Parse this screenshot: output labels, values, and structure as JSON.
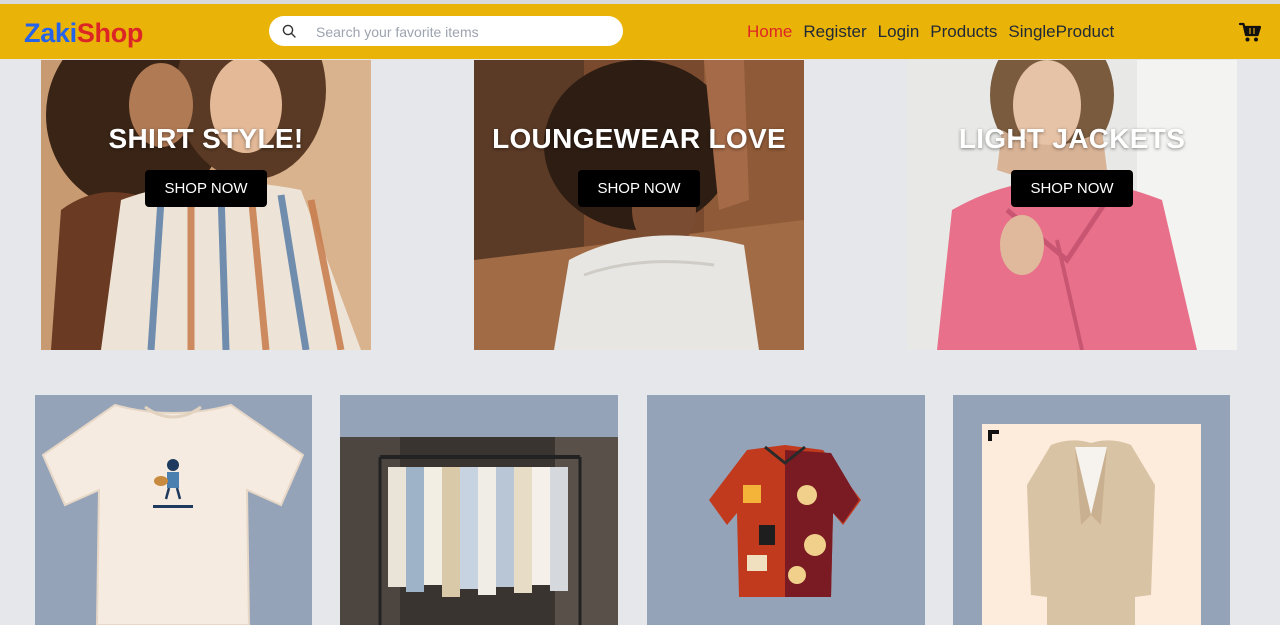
{
  "brand": {
    "part1": "Zaki",
    "part2": "Shop"
  },
  "search": {
    "placeholder": "Search your favorite items"
  },
  "nav": {
    "items": [
      {
        "label": "Home"
      },
      {
        "label": "Register"
      },
      {
        "label": "Login"
      },
      {
        "label": "Products"
      },
      {
        "label": "SingleProduct"
      }
    ]
  },
  "banners": [
    {
      "title": "SHIRT STYLE!",
      "cta": "SHOP NOW"
    },
    {
      "title": "LOUNGEWEAR LOVE",
      "cta": "SHOP NOW"
    },
    {
      "title": "LIGHT JACKETS",
      "cta": "SHOP NOW"
    }
  ],
  "icons": {
    "search": "search-icon",
    "cart": "cart-icon"
  },
  "colors": {
    "navbar": "#eab308",
    "brand_blue": "#2563eb",
    "brand_red": "#dc2626",
    "active_link": "#dc2626",
    "page_bg": "#e5e7eb",
    "card_bg": "#94a3b8"
  }
}
